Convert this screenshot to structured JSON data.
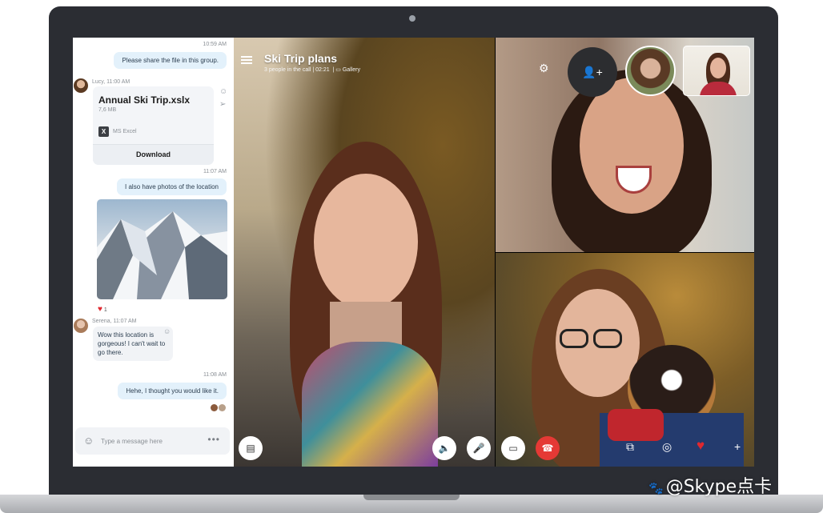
{
  "chat": {
    "messages": [
      {
        "time": "10:59 AM",
        "text": "Please share the file in this group."
      },
      {
        "sender": "Lucy, 11:00 AM",
        "file": {
          "name": "Annual Ski Trip.xslx",
          "size": "7,6 MB",
          "type": "MS Excel",
          "action": "Download"
        }
      },
      {
        "time": "11:07 AM",
        "text": "I also have photos of the location"
      },
      {
        "reaction_count": "1"
      },
      {
        "sender": "Serena, 11:07 AM",
        "text": "Wow this location is gorgeous! I can't wait to go there."
      },
      {
        "time": "11:08 AM",
        "text": "Hehe, I thought you would like it."
      }
    ],
    "composer": {
      "placeholder": "Type a message here"
    }
  },
  "call": {
    "title": "Ski Trip plans",
    "subtitle": "3 people in the call | 02:21",
    "gallery_label": "Gallery"
  },
  "icons": [
    "menu-icon",
    "settings-icon",
    "add-person-icon",
    "chat-icon",
    "speaker-icon",
    "microphone-icon",
    "video-icon",
    "end-call-icon",
    "switch-screen-icon",
    "snapshot-icon",
    "heart-icon",
    "plus-icon",
    "emoji-icon",
    "more-icon"
  ],
  "colors": {
    "end_call": "#e53935",
    "bubble_me": "#e3f1fb",
    "heart": "#e0282f"
  },
  "watermark": "@Skype点卡"
}
